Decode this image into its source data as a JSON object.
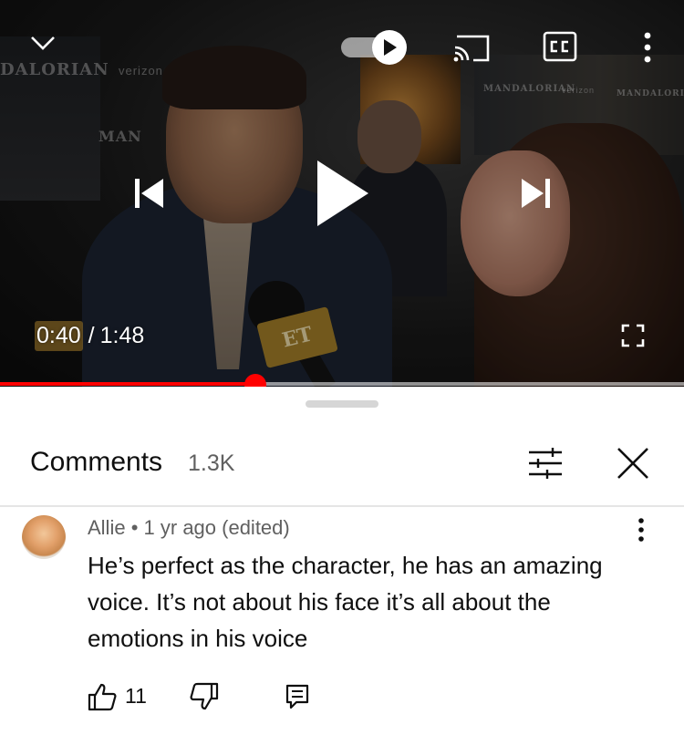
{
  "video": {
    "bg_texts": [
      "DALORIAN",
      "verizon",
      "MAN",
      "MANDALORIAN",
      "verizon",
      "MANDALORIAN"
    ],
    "mic_logo": "ET",
    "current_time": "0:40",
    "separator": "/",
    "duration": "1:48",
    "progress_fraction": 0.373,
    "accent_color": "#ff0000",
    "icons": [
      "chevron-down-icon",
      "autoplay-toggle",
      "cast-icon",
      "cc-icon",
      "more-vert-icon",
      "previous-icon",
      "play-icon",
      "next-icon",
      "fullscreen-icon"
    ]
  },
  "comments": {
    "title": "Comments",
    "count": "1.3K",
    "items": [
      {
        "author": "Allie",
        "bullet": "•",
        "age": "1 yr ago (edited)",
        "text": "He’s perfect as the character, he has an amazing voice. It’s not about his face it’s all about the emotions in his voice",
        "likes": "11"
      }
    ]
  }
}
